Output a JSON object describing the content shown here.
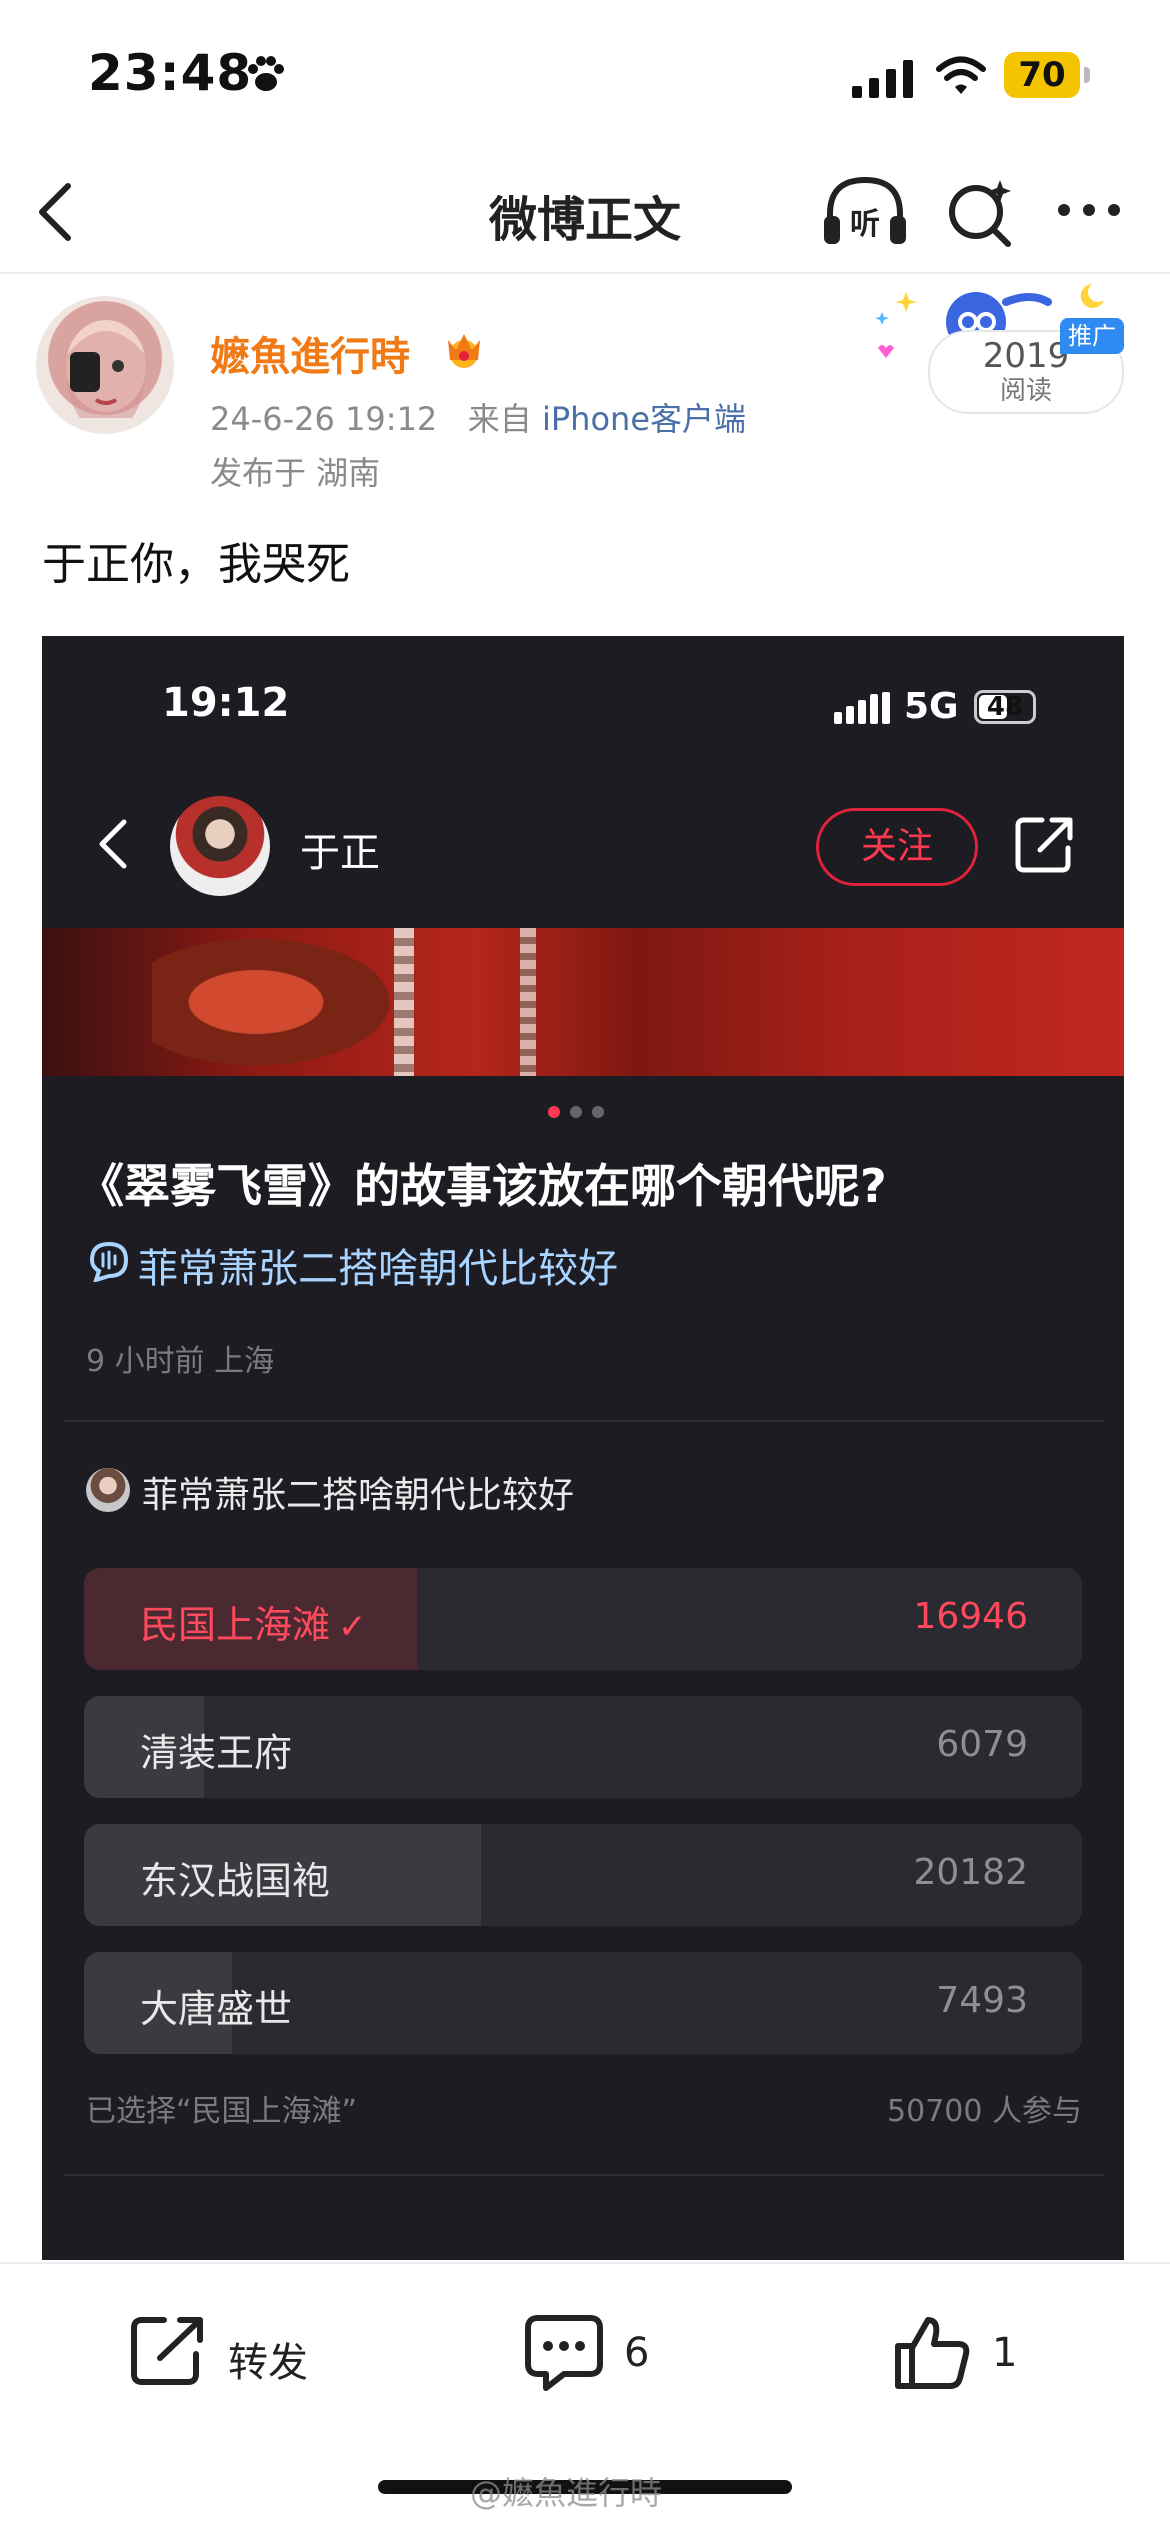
{
  "status_bar": {
    "time": "23:48",
    "battery": "70"
  },
  "nav": {
    "title": "微博正文"
  },
  "post": {
    "username": "嬷魚進行時",
    "date": "24-6-26 19:12",
    "source_prefix": "来自",
    "source": "iPhone客户端",
    "location": "发布于 湖南",
    "reads": "2019",
    "reads_label": "阅读",
    "promo_tag": "推广",
    "text": "于正你，我哭死"
  },
  "embed": {
    "time": "19:12",
    "network": "5G",
    "battery": "48",
    "author": "于正",
    "follow": "关注",
    "question": "《翠雾飞雪》的故事该放在哪个朝代呢?",
    "topic": "菲常萧张二搭啥朝代比较好",
    "time_location": "9 小时前 上海",
    "poll": {
      "title": "菲常萧张二搭啥朝代比较好",
      "options": [
        {
          "label": "民国上海滩",
          "count": "16946",
          "selected": true,
          "share": 0.334
        },
        {
          "label": "清装王府",
          "count": "6079",
          "selected": false,
          "share": 0.12
        },
        {
          "label": "东汉战国袍",
          "count": "20182",
          "selected": false,
          "share": 0.398
        },
        {
          "label": "大唐盛世",
          "count": "7493",
          "selected": false,
          "share": 0.148
        }
      ],
      "selected_note": "已选择“民国上海滩”",
      "participants": "50700 人参与"
    }
  },
  "actions": {
    "repost": "转发",
    "comments": "6",
    "likes": "1"
  },
  "watermark": "@嬷魚進行時",
  "colors": {
    "username": "#f07a16",
    "link": "#4b6fa8",
    "follow": "#e0223a",
    "selected": "#ff4a5e"
  }
}
